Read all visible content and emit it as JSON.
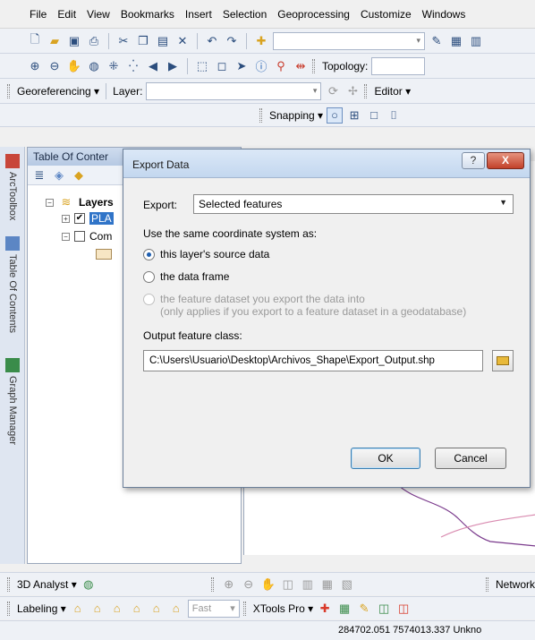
{
  "menu": {
    "items": [
      "File",
      "Edit",
      "View",
      "Bookmarks",
      "Insert",
      "Selection",
      "Geoprocessing",
      "Customize",
      "Windows"
    ]
  },
  "toolbars": {
    "topology_label": "Topology:",
    "georeferencing_label": "Georeferencing ▾",
    "layer_label": "Layer:",
    "editor_label": "Editor ▾",
    "snapping_label": "Snapping ▾"
  },
  "side_tabs": [
    "ArcToolbox",
    "Table Of Contents",
    "Graph Manager"
  ],
  "toc": {
    "title": "Table Of Conter",
    "layers_label": "Layers",
    "layer1_label": "PLA",
    "layer2_label": "Com"
  },
  "dialog": {
    "title": "Export Data",
    "help_label": "?",
    "close_label": "X",
    "export_label": "Export:",
    "export_value": "Selected features",
    "coord_label": "Use the same coordinate system as:",
    "options": [
      {
        "label": "this layer's source data",
        "selected": true,
        "disabled": false
      },
      {
        "label": "the data frame",
        "selected": false,
        "disabled": false
      },
      {
        "label": "the feature dataset you export the data into",
        "selected": false,
        "disabled": true
      }
    ],
    "option3_note": "(only applies if you export to a feature dataset in a geodatabase)",
    "output_label": "Output feature class:",
    "output_value": "C:\\Users\\Usuario\\Desktop\\Archivos_Shape\\Export_Output.shp",
    "ok_label": "OK",
    "cancel_label": "Cancel"
  },
  "bottom_toolbars": {
    "analyst_label": "3D Analyst ▾",
    "network_label": "Network",
    "labeling_label": "Labeling ▾",
    "fast_value": "Fast",
    "xtools_label": "XTools Pro ▾"
  },
  "status": {
    "coordinates": "284702.051  7574013.337 Unkno"
  },
  "colors": {
    "accent": "#1f5fb0",
    "map_line_purple": "#7a3a8c",
    "map_line_pink": "#d98bb0",
    "close_red": "#c2412a"
  }
}
